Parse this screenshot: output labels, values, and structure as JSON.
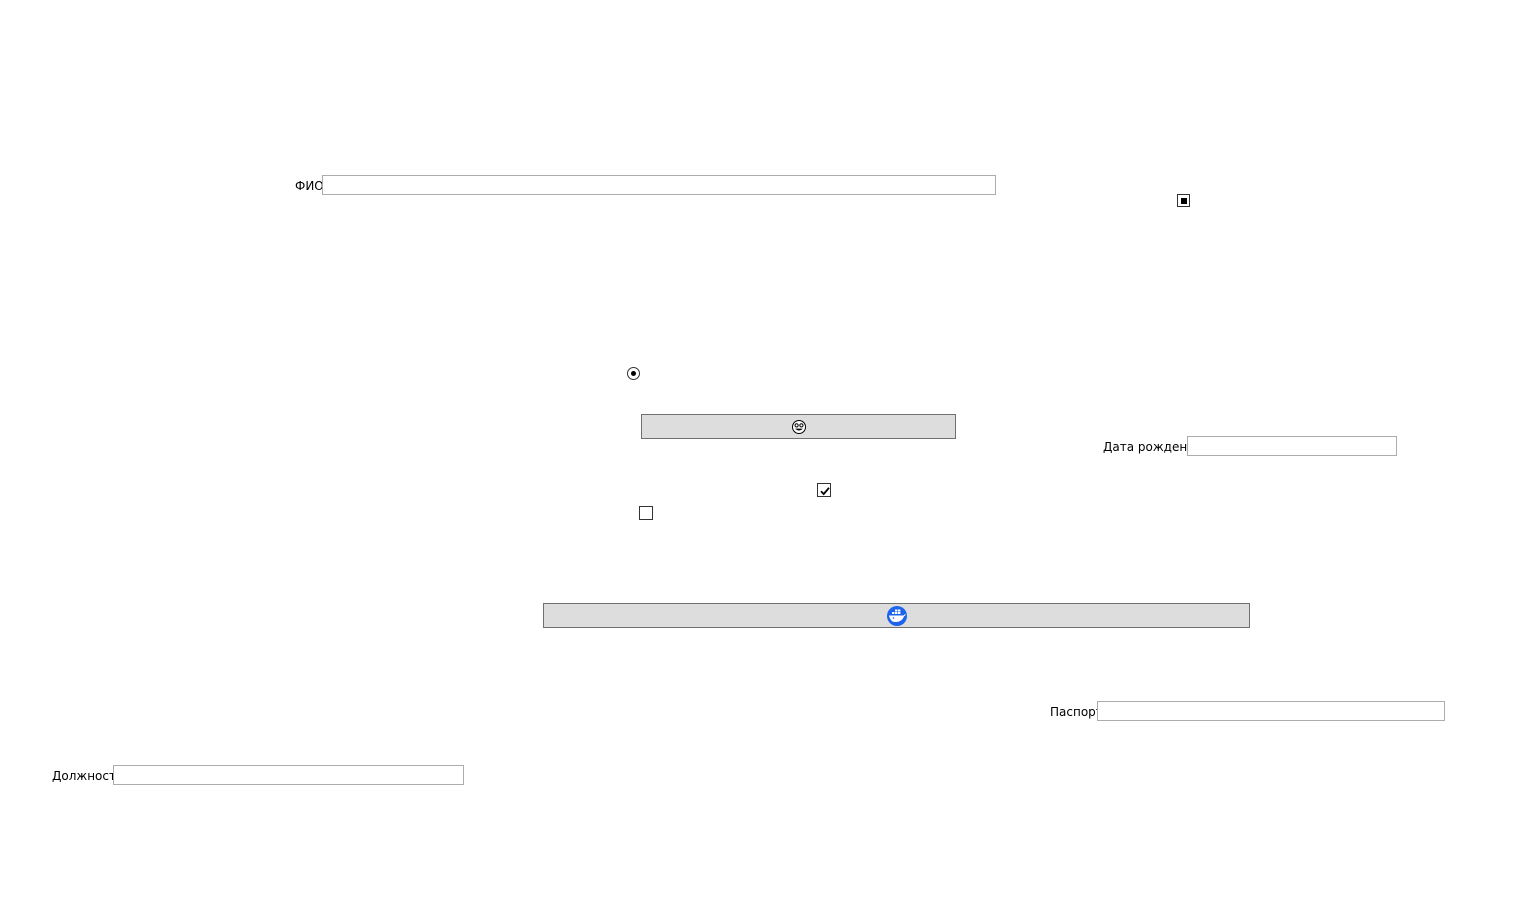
{
  "form": {
    "fio": {
      "label": "ФИО",
      "value": "",
      "placeholder": ""
    },
    "birth_date": {
      "label": "Дата рождения",
      "value": "",
      "placeholder": ""
    },
    "passport": {
      "label": "Паспорт",
      "value": "",
      "placeholder": ""
    },
    "position": {
      "label": "Должность",
      "value": "",
      "placeholder": ""
    }
  },
  "controls": {
    "radio_selected": true,
    "checkbox_indeterminate": true,
    "checkbox_checked": true,
    "checkbox_unchecked": false
  },
  "buttons": {
    "emoji_button_icon": "face-emoji-icon",
    "docker_button_icon": "docker-whale-icon"
  },
  "colors": {
    "button_bg": "#dddddd",
    "button_border": "#707070",
    "field_border": "#acacac",
    "docker_blue": "#1d63ed"
  }
}
